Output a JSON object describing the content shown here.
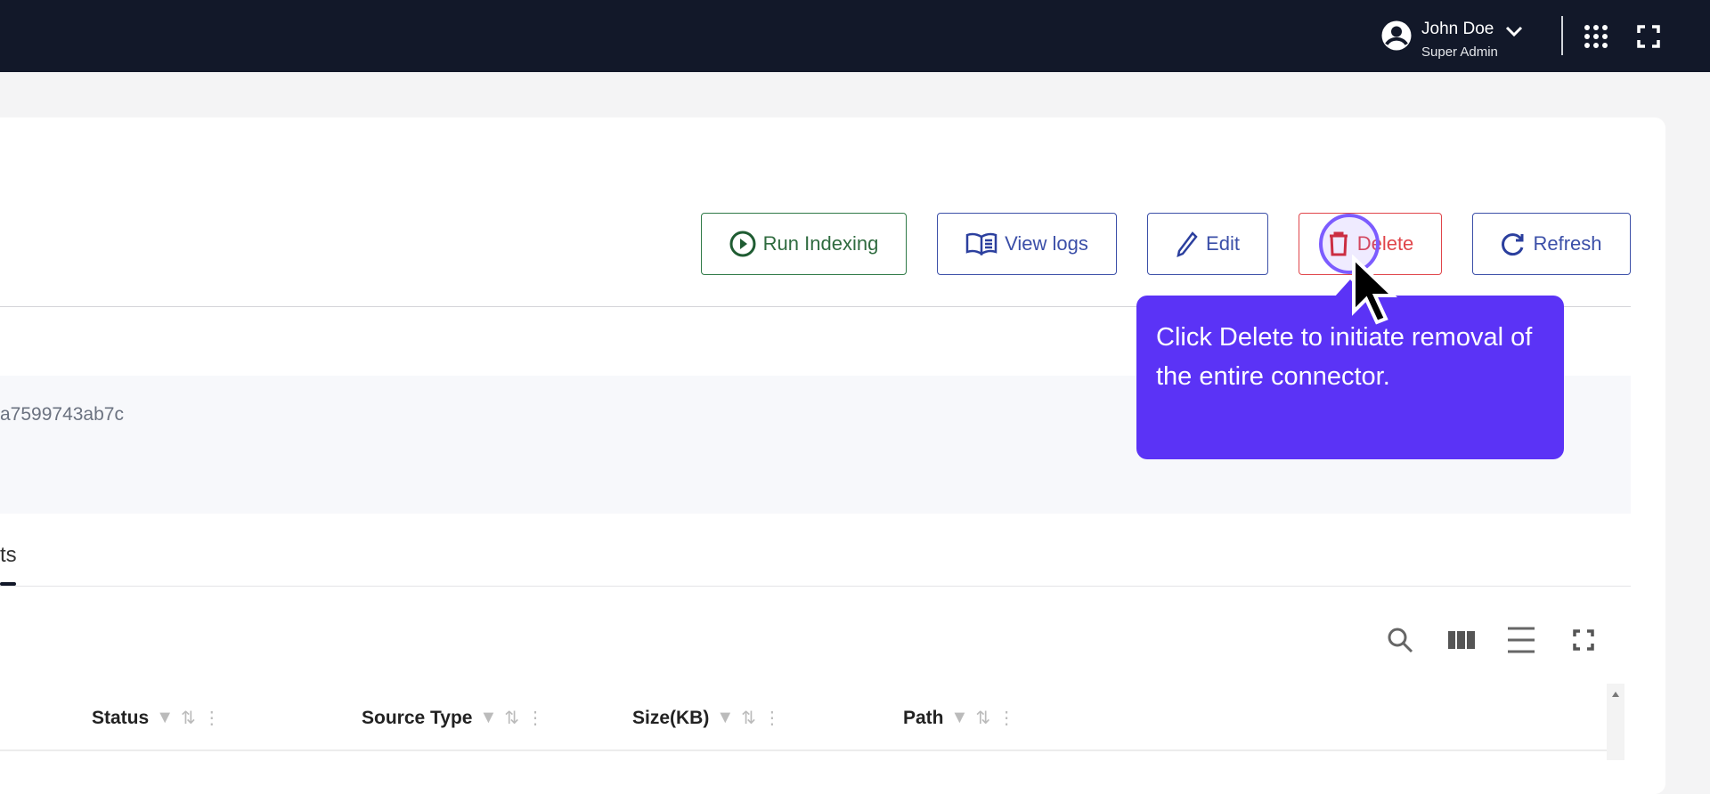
{
  "header": {
    "user_name": "John Doe",
    "user_role": "Super Admin",
    "icons": [
      "user-avatar-icon",
      "chevron-down-icon",
      "apps-grid-icon",
      "fullscreen-icon"
    ]
  },
  "actions": {
    "run_indexing": "Run Indexing",
    "view_logs": "View logs",
    "edit": "Edit",
    "delete": "Delete",
    "refresh": "Refresh"
  },
  "details": {
    "id_fragment": "a7599743ab7c"
  },
  "tabs": {
    "active_fragment": "ts"
  },
  "table": {
    "columns": [
      "Status",
      "Source Type",
      "Size(KB)",
      "Path"
    ]
  },
  "tooltip": {
    "text": "Click Delete to initiate removal of the entire connector."
  },
  "colors": {
    "topbar": "#121829",
    "tooltip": "#5b33f6",
    "green": "#2f6b3f",
    "blue": "#3b4fa8",
    "red": "#e0454a"
  }
}
